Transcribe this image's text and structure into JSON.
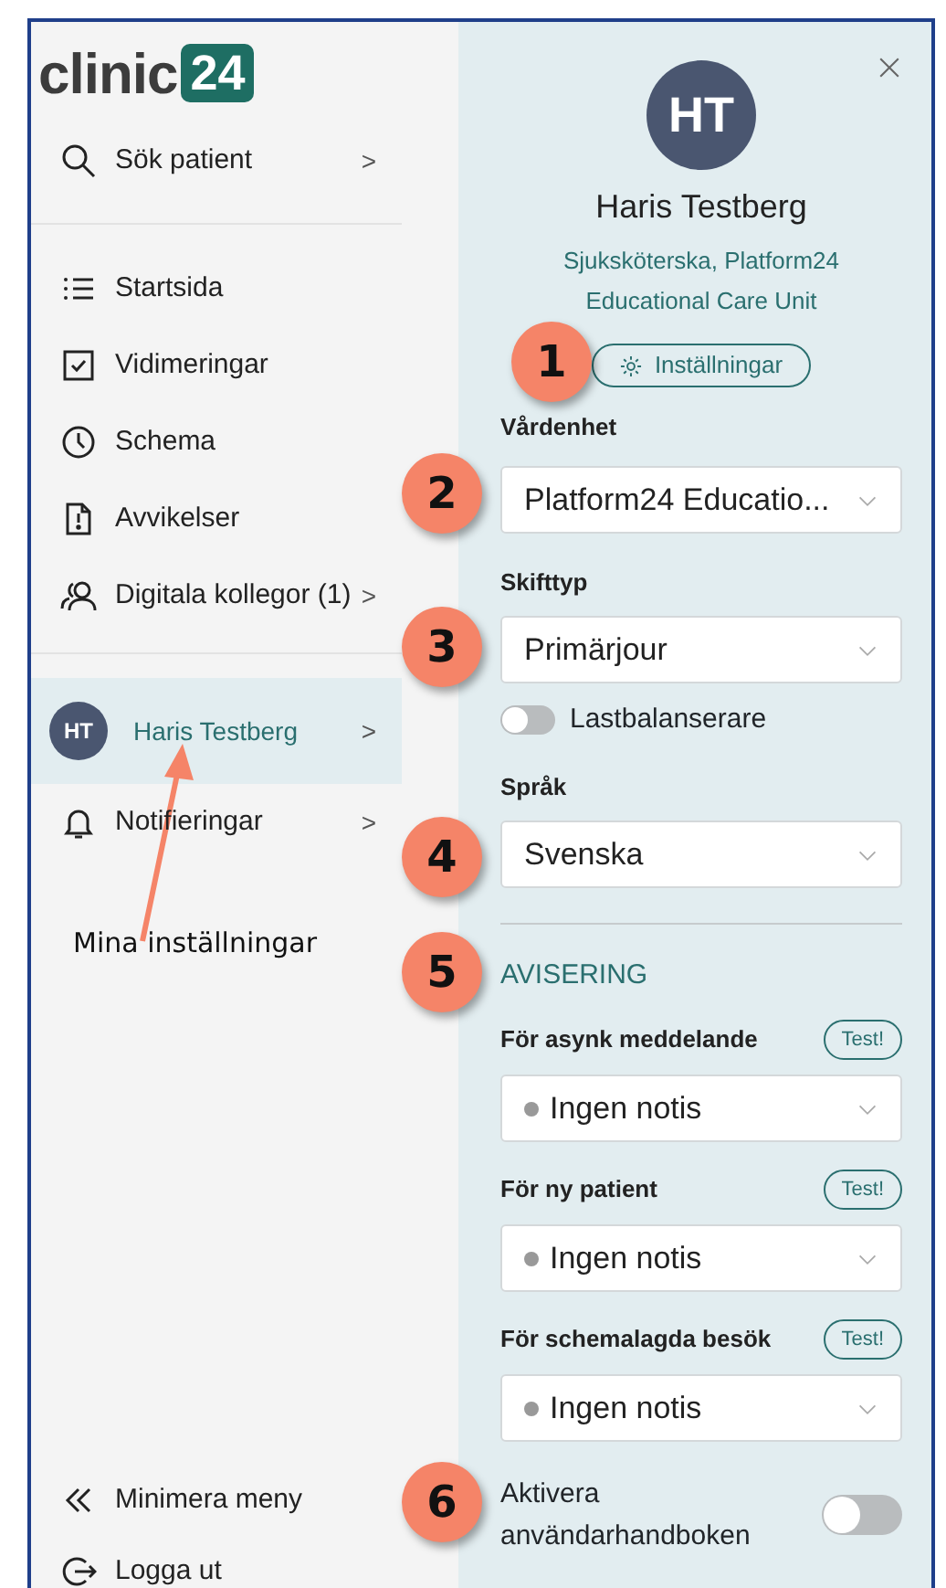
{
  "logo": {
    "text": "clinic",
    "badge": "24"
  },
  "search": {
    "label": "Sök patient",
    "chevron": ">"
  },
  "nav": [
    {
      "label": "Startsida"
    },
    {
      "label": "Vidimeringar"
    },
    {
      "label": "Schema"
    },
    {
      "label": "Avvikelser"
    },
    {
      "label": "Digitala kollegor (1)",
      "chevron": ">"
    }
  ],
  "profile_item": {
    "initials": "HT",
    "name": "Haris Testberg",
    "chevron": ">",
    "selected": true
  },
  "notifications_item": {
    "label": "Notifieringar",
    "chevron": ">"
  },
  "footer": [
    {
      "label": "Minimera meny"
    },
    {
      "label": "Logga ut"
    }
  ],
  "panel": {
    "initials": "HT",
    "name": "Haris Testberg",
    "role": "Sjuksköterska, Platform24 Educational Care Unit",
    "settings_button": "Inställningar",
    "settings": [
      {
        "kind": "select",
        "label": "Vårdenhet",
        "value": "Platform24 Educatio..."
      },
      {
        "kind": "select",
        "label": "Skifttyp",
        "value": "Primärjour"
      },
      {
        "kind": "toggle",
        "label": "Lastbalanserare",
        "on": false
      },
      {
        "kind": "select",
        "label": "Språk",
        "value": "Svenska"
      }
    ],
    "notification_heading": "AVISERING",
    "notifications": [
      {
        "label": "För asynk meddelande",
        "test": "Test!",
        "value": "Ingen notis"
      },
      {
        "label": "För ny patient",
        "test": "Test!",
        "value": "Ingen notis"
      },
      {
        "label": "För schemalagda besök",
        "test": "Test!",
        "value": "Ingen notis"
      }
    ],
    "guide_toggle": {
      "label": "Aktivera användarhandboken",
      "on": false
    }
  },
  "annotations": {
    "callouts": [
      "1",
      "2",
      "3",
      "4",
      "5",
      "6"
    ],
    "arrow_label": "Mina inställningar"
  }
}
